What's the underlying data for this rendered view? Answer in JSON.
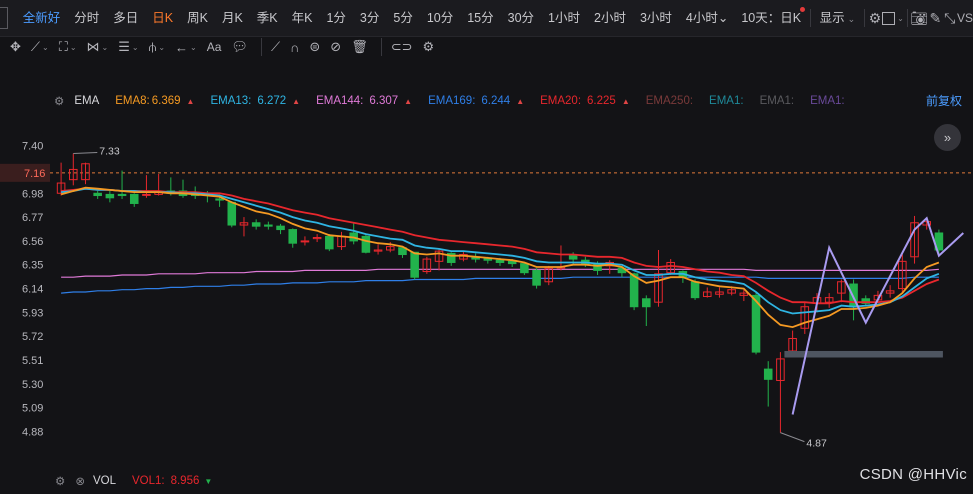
{
  "periods": [
    "全新好",
    "分时",
    "多日",
    "日K",
    "周K",
    "月K",
    "季K",
    "年K",
    "1分",
    "3分",
    "5分",
    "10分",
    "15分",
    "30分",
    "1小时",
    "2小时",
    "3小时",
    "4小时"
  ],
  "period_active": "日K",
  "multi_view_label": "10天：日K",
  "display_label": "显示",
  "legend": {
    "indicator": "EMA",
    "ema8": "EMA8:",
    "ema8_val": "6.369",
    "ema13": "EMA13:",
    "ema13_val": "6.272",
    "ema144": "EMA144:",
    "ema144_val": "6.307",
    "ema169": "EMA169:",
    "ema169_val": "6.244",
    "ema20": "EMA20:",
    "ema20_val": "6.225",
    "ema250": "EMA250:",
    "ema1a": "EMA1:",
    "ema1b": "EMA1:",
    "ema1c": "EMA1:",
    "restore": "前复权",
    "colors": {
      "ema8": "#f59a23",
      "ema13": "#2fb5e3",
      "ema144": "#e07ad8",
      "ema169": "#2f7fe8",
      "ema20": "#e8272d",
      "ema250": "#7a3a3a",
      "ema1a": "#1f8a9a",
      "ema1b": "#5a5a5e",
      "ema1c": "#6a4a9a"
    }
  },
  "bottom": {
    "indicator": "VOL",
    "vol1": "VOL1:",
    "vol1_val": "8.956"
  },
  "watermark": "CSDN @HHVic",
  "chart_data": {
    "type": "candlestick",
    "y_ticks": [
      "7.40",
      "7.19",
      "6.98",
      "6.77",
      "6.56",
      "6.35",
      "6.14",
      "5.93",
      "5.72",
      "5.51",
      "5.30",
      "5.09",
      "4.88"
    ],
    "ylim": [
      4.77,
      7.52
    ],
    "current_price": "7.16",
    "high_label": "7.33",
    "low_label": "4.87",
    "candles": [
      [
        6.98,
        7.07,
        7.25,
        6.96
      ],
      [
        7.1,
        7.19,
        7.33,
        7.05
      ],
      [
        7.1,
        7.24,
        7.25,
        7.06
      ],
      [
        6.98,
        6.96,
        7.0,
        6.93
      ],
      [
        6.97,
        6.94,
        7.0,
        6.9
      ],
      [
        6.97,
        6.96,
        7.18,
        6.93
      ],
      [
        6.97,
        6.89,
        6.98,
        6.86
      ],
      [
        6.97,
        6.97,
        7.14,
        6.94
      ],
      [
        6.97,
        7.0,
        7.15,
        6.96
      ],
      [
        7.0,
        6.98,
        7.12,
        6.96
      ],
      [
        7.0,
        6.96,
        7.1,
        6.94
      ],
      [
        6.99,
        6.96,
        7.04,
        6.93
      ],
      [
        6.98,
        6.96,
        7.0,
        6.9
      ],
      [
        6.93,
        6.92,
        6.97,
        6.86
      ],
      [
        6.9,
        6.7,
        6.91,
        6.68
      ],
      [
        6.7,
        6.72,
        6.77,
        6.6
      ],
      [
        6.72,
        6.69,
        6.75,
        6.66
      ],
      [
        6.7,
        6.69,
        6.73,
        6.66
      ],
      [
        6.69,
        6.66,
        6.71,
        6.62
      ],
      [
        6.66,
        6.54,
        6.67,
        6.5
      ],
      [
        6.56,
        6.56,
        6.6,
        6.52
      ],
      [
        6.58,
        6.59,
        6.62,
        6.55
      ],
      [
        6.6,
        6.49,
        6.62,
        6.47
      ],
      [
        6.51,
        6.6,
        6.64,
        6.48
      ],
      [
        6.63,
        6.56,
        6.72,
        6.53
      ],
      [
        6.6,
        6.46,
        6.62,
        6.45
      ],
      [
        6.47,
        6.48,
        6.53,
        6.44
      ],
      [
        6.48,
        6.51,
        6.55,
        6.46
      ],
      [
        6.5,
        6.44,
        6.51,
        6.41
      ],
      [
        6.46,
        6.24,
        6.46,
        6.22
      ],
      [
        6.29,
        6.4,
        6.42,
        6.27
      ],
      [
        6.38,
        6.47,
        6.49,
        6.3
      ],
      [
        6.45,
        6.37,
        6.46,
        6.34
      ],
      [
        6.4,
        6.44,
        6.47,
        6.38
      ],
      [
        6.42,
        6.4,
        6.45,
        6.37
      ],
      [
        6.41,
        6.39,
        6.42,
        6.36
      ],
      [
        6.39,
        6.37,
        6.41,
        6.34
      ],
      [
        6.38,
        6.36,
        6.4,
        6.33
      ],
      [
        6.36,
        6.28,
        6.37,
        6.26
      ],
      [
        6.3,
        6.17,
        6.32,
        6.14
      ],
      [
        6.2,
        6.32,
        6.34,
        6.17
      ],
      [
        6.32,
        6.33,
        6.52,
        6.3
      ],
      [
        6.43,
        6.4,
        6.46,
        6.35
      ],
      [
        6.39,
        6.35,
        6.42,
        6.33
      ],
      [
        6.36,
        6.3,
        6.38,
        6.26
      ],
      [
        6.34,
        6.37,
        6.39,
        6.27
      ],
      [
        6.32,
        6.28,
        6.34,
        6.24
      ],
      [
        6.27,
        5.98,
        6.28,
        5.95
      ],
      [
        6.05,
        5.98,
        6.08,
        5.81
      ],
      [
        6.02,
        6.27,
        6.48,
        5.98
      ],
      [
        6.28,
        6.37,
        6.4,
        6.26
      ],
      [
        6.29,
        6.24,
        6.3,
        6.19
      ],
      [
        6.2,
        6.06,
        6.22,
        6.04
      ],
      [
        6.07,
        6.11,
        6.15,
        6.06
      ],
      [
        6.09,
        6.11,
        6.15,
        6.06
      ],
      [
        6.1,
        6.13,
        6.16,
        6.08
      ],
      [
        6.08,
        6.1,
        6.13,
        6.03
      ],
      [
        6.08,
        5.58,
        6.1,
        5.56
      ],
      [
        5.43,
        5.34,
        5.5,
        5.1
      ],
      [
        5.33,
        5.52,
        5.58,
        4.87
      ],
      [
        5.59,
        5.7,
        5.77,
        5.54
      ],
      [
        5.79,
        5.98,
        6.02,
        5.74
      ],
      [
        6.01,
        6.06,
        6.1,
        5.93
      ],
      [
        6.02,
        6.06,
        6.1,
        5.97
      ],
      [
        6.1,
        6.2,
        6.22,
        6.02
      ],
      [
        6.18,
        5.98,
        6.22,
        5.86
      ],
      [
        6.05,
        6.01,
        6.08,
        5.98
      ],
      [
        6.04,
        6.08,
        6.12,
        6.02
      ],
      [
        6.1,
        6.12,
        6.17,
        6.06
      ],
      [
        6.14,
        6.38,
        6.44,
        6.1
      ],
      [
        6.42,
        6.72,
        6.78,
        6.36
      ],
      [
        6.7,
        6.73,
        6.76,
        6.66
      ],
      [
        6.63,
        6.48,
        6.66,
        6.44
      ]
    ],
    "ema8": [
      6.97,
      7.0,
      7.03,
      7.02,
      7.01,
      7.0,
      6.99,
      6.99,
      6.99,
      6.98,
      6.98,
      6.97,
      6.96,
      6.95,
      6.9,
      6.86,
      6.82,
      6.8,
      6.76,
      6.71,
      6.67,
      6.65,
      6.61,
      6.6,
      6.59,
      6.56,
      6.54,
      6.53,
      6.51,
      6.45,
      6.44,
      6.45,
      6.43,
      6.43,
      6.42,
      6.41,
      6.4,
      6.39,
      6.37,
      6.33,
      6.33,
      6.33,
      6.35,
      6.35,
      6.34,
      6.35,
      6.33,
      6.25,
      6.19,
      6.21,
      6.24,
      6.24,
      6.2,
      6.18,
      6.16,
      6.15,
      6.14,
      6.03,
      5.91,
      5.82,
      5.8,
      5.84,
      5.87,
      5.9,
      5.96,
      5.96,
      5.97,
      5.99,
      6.02,
      6.1,
      6.23,
      6.33,
      6.37
    ],
    "ema13": [
      6.99,
      7.0,
      7.02,
      7.01,
      7.01,
      7.0,
      7.0,
      6.99,
      6.99,
      6.99,
      6.98,
      6.98,
      6.97,
      6.96,
      6.93,
      6.9,
      6.87,
      6.84,
      6.81,
      6.77,
      6.74,
      6.72,
      6.69,
      6.67,
      6.65,
      6.62,
      6.6,
      6.58,
      6.57,
      6.52,
      6.5,
      6.49,
      6.47,
      6.47,
      6.46,
      6.45,
      6.44,
      6.43,
      6.41,
      6.38,
      6.37,
      6.37,
      6.37,
      6.37,
      6.36,
      6.36,
      6.35,
      6.3,
      6.26,
      6.26,
      6.27,
      6.27,
      6.24,
      6.22,
      6.21,
      6.2,
      6.18,
      6.11,
      6.02,
      5.95,
      5.92,
      5.93,
      5.94,
      5.95,
      5.99,
      5.98,
      5.99,
      6.0,
      6.02,
      6.07,
      6.15,
      6.23,
      6.27
    ],
    "ema20": [
      7.0,
      7.01,
      7.02,
      7.01,
      7.01,
      7.0,
      7.0,
      7.0,
      7.0,
      6.99,
      6.99,
      6.99,
      6.98,
      6.98,
      6.96,
      6.93,
      6.91,
      6.89,
      6.86,
      6.83,
      6.81,
      6.79,
      6.76,
      6.74,
      6.72,
      6.7,
      6.68,
      6.66,
      6.64,
      6.61,
      6.59,
      6.57,
      6.56,
      6.55,
      6.54,
      6.53,
      6.52,
      6.51,
      6.49,
      6.46,
      6.45,
      6.44,
      6.44,
      6.43,
      6.42,
      6.42,
      6.41,
      6.37,
      6.34,
      6.33,
      6.34,
      6.33,
      6.31,
      6.29,
      6.28,
      6.26,
      6.25,
      6.19,
      6.12,
      6.06,
      6.02,
      6.02,
      6.01,
      6.01,
      6.03,
      6.02,
      6.02,
      6.02,
      6.03,
      6.06,
      6.12,
      6.18,
      6.22
    ],
    "ema144": [
      6.24,
      6.24,
      6.25,
      6.25,
      6.25,
      6.26,
      6.26,
      6.26,
      6.27,
      6.27,
      6.27,
      6.27,
      6.28,
      6.28,
      6.28,
      6.28,
      6.29,
      6.29,
      6.29,
      6.29,
      6.3,
      6.3,
      6.3,
      6.3,
      6.3,
      6.3,
      6.31,
      6.31,
      6.31,
      6.31,
      6.31,
      6.31,
      6.31,
      6.31,
      6.31,
      6.31,
      6.31,
      6.31,
      6.31,
      6.31,
      6.31,
      6.31,
      6.31,
      6.31,
      6.31,
      6.31,
      6.31,
      6.31,
      6.31,
      6.31,
      6.31,
      6.31,
      6.31,
      6.31,
      6.31,
      6.31,
      6.31,
      6.3,
      6.3,
      6.3,
      6.3,
      6.3,
      6.3,
      6.3,
      6.3,
      6.3,
      6.3,
      6.3,
      6.3,
      6.3,
      6.3,
      6.3,
      6.31
    ],
    "ema169": [
      6.1,
      6.11,
      6.11,
      6.12,
      6.12,
      6.13,
      6.13,
      6.14,
      6.14,
      6.15,
      6.15,
      6.16,
      6.16,
      6.16,
      6.17,
      6.17,
      6.18,
      6.18,
      6.18,
      6.19,
      6.19,
      6.19,
      6.2,
      6.2,
      6.2,
      6.21,
      6.21,
      6.21,
      6.21,
      6.22,
      6.22,
      6.22,
      6.22,
      6.22,
      6.23,
      6.23,
      6.23,
      6.23,
      6.23,
      6.23,
      6.23,
      6.23,
      6.24,
      6.24,
      6.24,
      6.24,
      6.24,
      6.24,
      6.24,
      6.24,
      6.24,
      6.24,
      6.24,
      6.24,
      6.24,
      6.24,
      6.24,
      6.24,
      6.23,
      6.23,
      6.23,
      6.23,
      6.23,
      6.23,
      6.23,
      6.23,
      6.23,
      6.23,
      6.23,
      6.23,
      6.24,
      6.24,
      6.24
    ],
    "drawing_zigzag": [
      [
        5.12,
        5.03
      ],
      [
        5.3,
        6.5
      ],
      [
        6.05,
        5.84
      ],
      [
        6.1,
        6.6
      ],
      [
        6.4,
        6.43
      ]
    ]
  }
}
